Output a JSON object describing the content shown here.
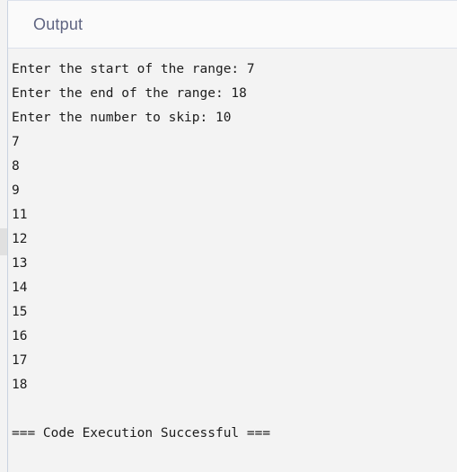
{
  "panel": {
    "name": "output-panel",
    "header": {
      "title": "Output"
    },
    "colors": {
      "header_bg": "#fafafa",
      "body_bg": "#f3f3f3",
      "divider": "#dbe1ec",
      "left_rule": "#c9d3e0",
      "title_text": "#5f6582",
      "console_text": "#1c1c1c",
      "scroll_thumb": "#e0e0e0"
    },
    "console": {
      "lines": [
        "Enter the start of the range: 7",
        "Enter the end of the range: 18",
        "Enter the number to skip: 10",
        "7",
        "8",
        "9",
        "11",
        "12",
        "13",
        "14",
        "15",
        "16",
        "17",
        "18",
        "",
        "=== Code Execution Successful ==="
      ],
      "prompts": [
        {
          "label": "Enter the start of the range:",
          "value": "7"
        },
        {
          "label": "Enter the end of the range:",
          "value": "18"
        },
        {
          "label": "Enter the number to skip:",
          "value": "10"
        }
      ],
      "printed_numbers": [
        "7",
        "8",
        "9",
        "11",
        "12",
        "13",
        "14",
        "15",
        "16",
        "17",
        "18"
      ],
      "status_message": "=== Code Execution Successful ==="
    },
    "scrollbar": {
      "orientation": "vertical",
      "position": "left"
    }
  }
}
